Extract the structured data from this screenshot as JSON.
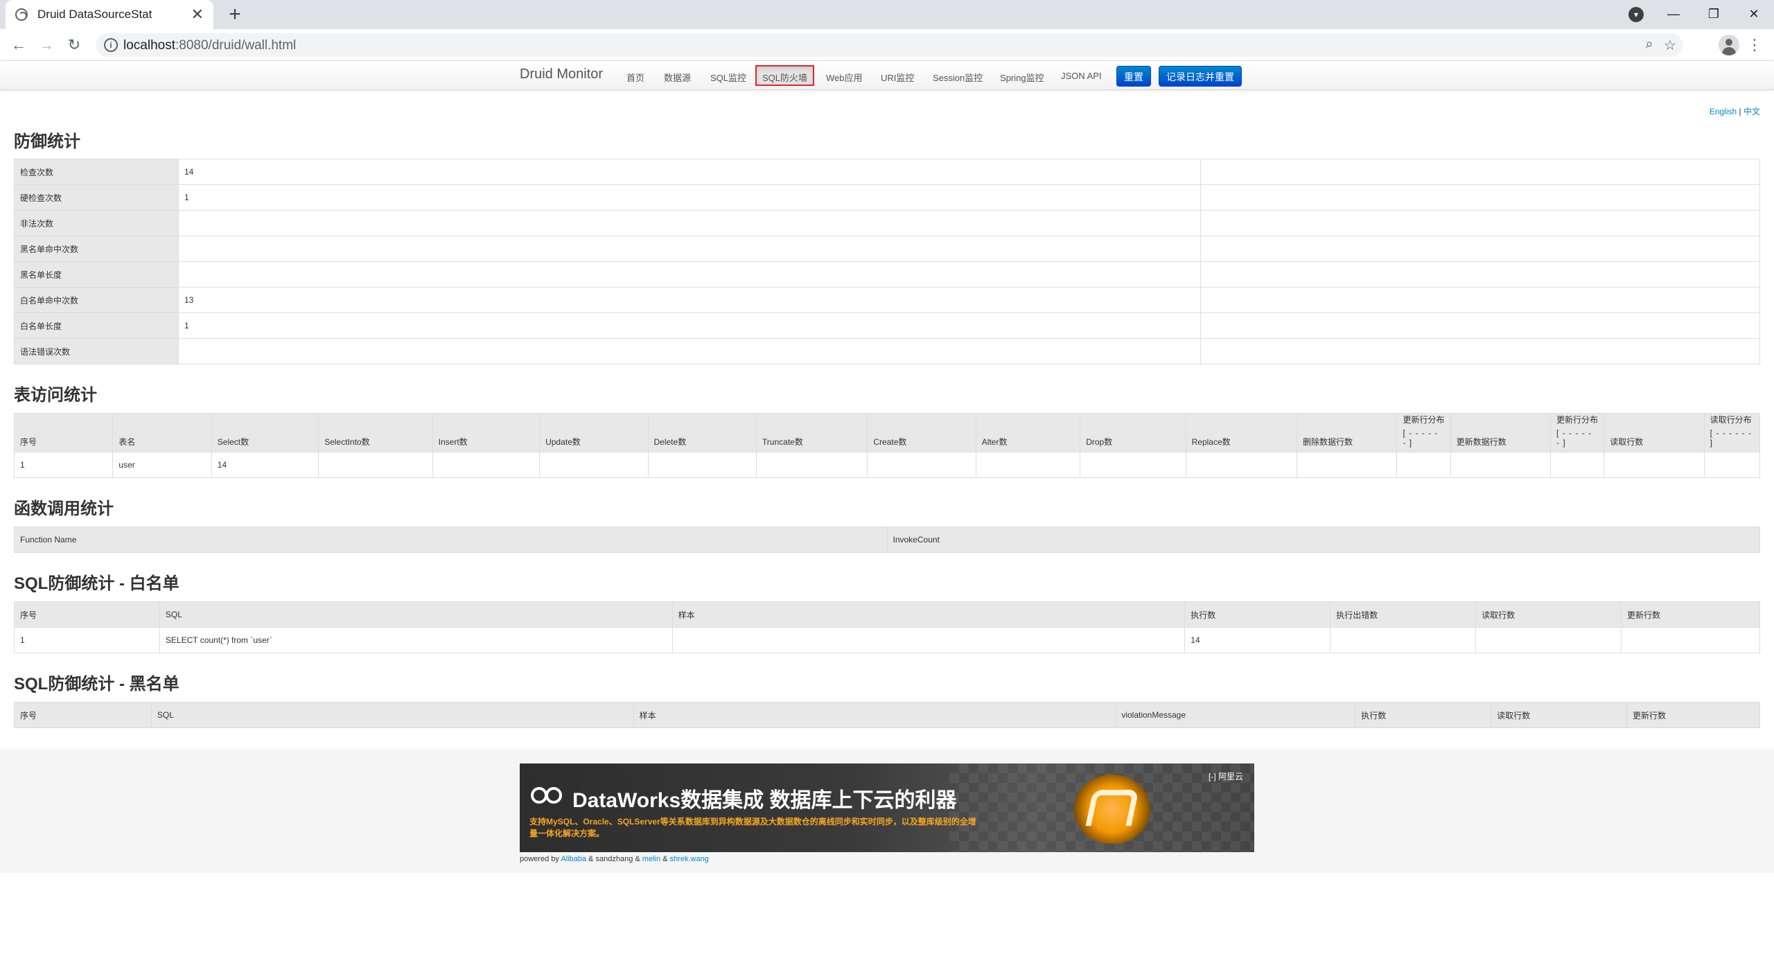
{
  "browser": {
    "tab_title": "Druid DataSourceStat",
    "tab_close": "✕",
    "new_tab": "+",
    "url_host": "localhost",
    "url_rest": ":8080/druid/wall.html",
    "window_controls": [
      "—",
      "❐",
      "✕"
    ]
  },
  "nav": {
    "brand": "Druid Monitor",
    "items": [
      "首页",
      "数据源",
      "SQL监控",
      "SQL防火墙",
      "Web应用",
      "URI监控",
      "Session监控",
      "Spring监控",
      "JSON API"
    ],
    "active_index": 3,
    "reset_label": "重置",
    "log_reset_label": "记录日志并重置"
  },
  "lang": {
    "english": "English",
    "sep": "|",
    "chinese": "中文"
  },
  "defense": {
    "title": "防御统计",
    "rows": [
      {
        "label": "检查次数",
        "value": "14"
      },
      {
        "label": "硬检查次数",
        "value": "1"
      },
      {
        "label": "非法次数",
        "value": ""
      },
      {
        "label": "黑名单命中次数",
        "value": ""
      },
      {
        "label": "黑名单长度",
        "value": ""
      },
      {
        "label": "白名单命中次数",
        "value": "13"
      },
      {
        "label": "白名单长度",
        "value": "1"
      },
      {
        "label": "语法错误次数",
        "value": ""
      }
    ]
  },
  "table_access": {
    "title": "表访问统计",
    "headers": [
      "序号",
      "表名",
      "Select数",
      "SelectInto数",
      "Insert数",
      "Update数",
      "Delete数",
      "Truncate数",
      "Create数",
      "Alter数",
      "Drop数",
      "Replace数",
      "删除数据行数",
      "更新行分布",
      "更新数据行数",
      "更新行分布",
      "读取行数",
      "读取行分布"
    ],
    "dist_marker": "[ - - - - - - ]",
    "rows": [
      [
        "1",
        "user",
        "14",
        "",
        "",
        "",
        "",
        "",
        "",
        "",
        "",
        "",
        "",
        "",
        "",
        "",
        "",
        ""
      ]
    ]
  },
  "function_stats": {
    "title": "函数调用统计",
    "headers": [
      "Function Name",
      "InvokeCount"
    ]
  },
  "whitelist": {
    "title": "SQL防御统计 - 白名单",
    "headers": [
      "序号",
      "SQL",
      "样本",
      "执行数",
      "执行出错数",
      "读取行数",
      "更新行数"
    ],
    "rows": [
      [
        "1",
        "SELECT count(*) from `user`",
        "",
        "14",
        "",
        "",
        ""
      ]
    ]
  },
  "blacklist": {
    "title": "SQL防御统计 - 黑名单",
    "headers": [
      "序号",
      "SQL",
      "样本",
      "violationMessage",
      "执行数",
      "读取行数",
      "更新行数"
    ]
  },
  "footer": {
    "banner_title": "DataWorks数据集成 数据库上下云的利器",
    "banner_sub": "支持MySQL、Oracle、SQLServer等关系数据库到异构数据源及大数据数仓的离线同步和实时同步，以及整库级别的全增量一体化解决方案。",
    "banner_brand": "阿里云",
    "powered_prefix": "powered by",
    "alibaba": "Alibaba",
    "amp1": "& sandzhang &",
    "melin": "melin",
    "amp2": "&",
    "shrek": "shrek.wang"
  }
}
